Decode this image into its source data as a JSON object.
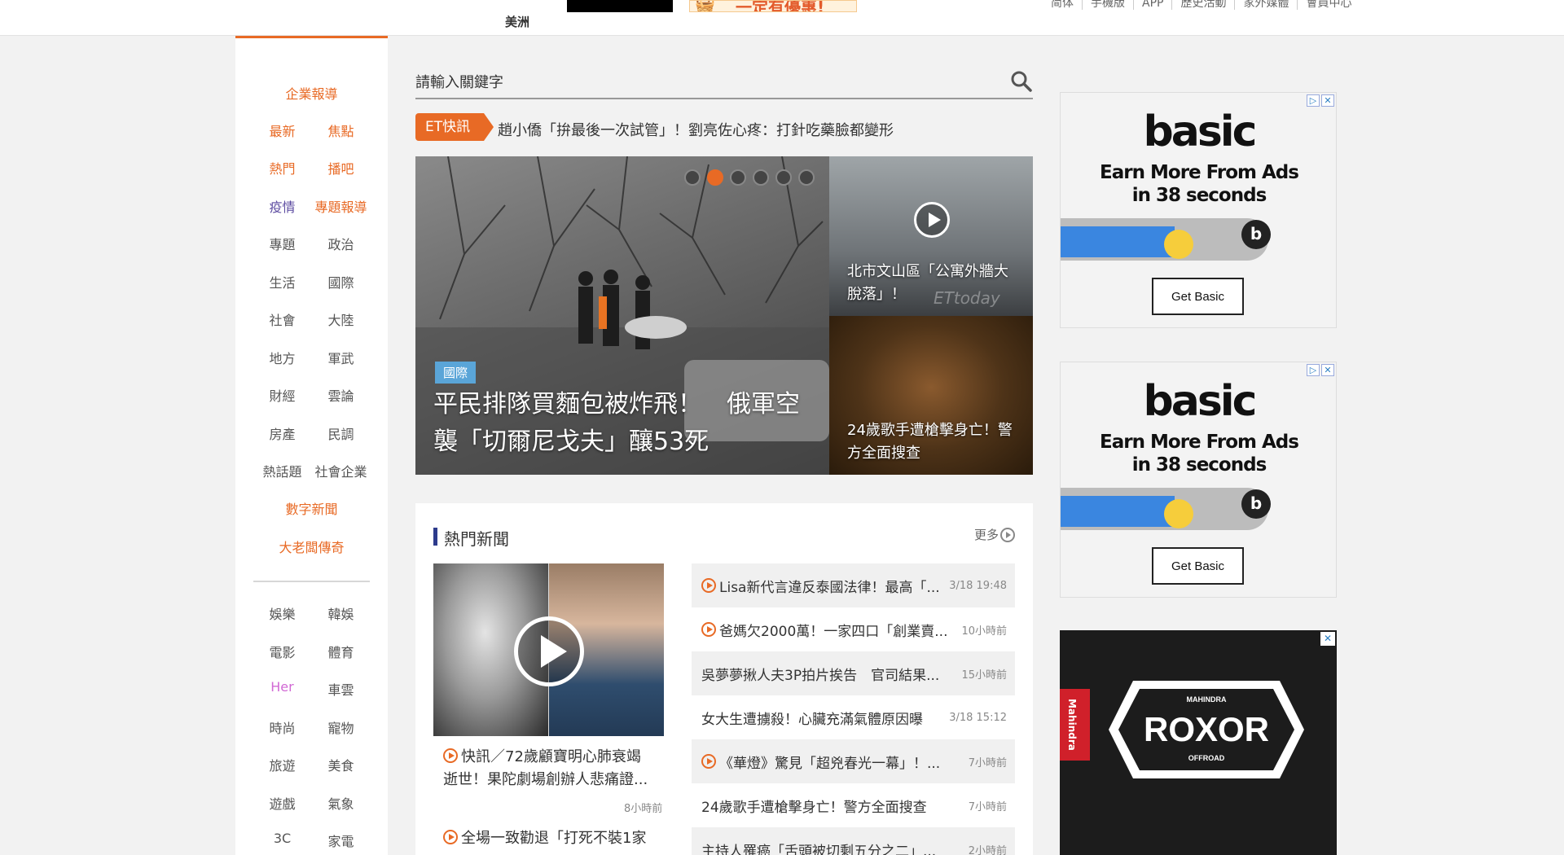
{
  "header": {
    "region": "美洲",
    "promo_text": "一定有優惠!",
    "top_links": [
      "简体",
      "手機版",
      "APP",
      "歷史活動",
      "家外媒體",
      "會員中心"
    ]
  },
  "leftnav": {
    "corporate": "企業報導",
    "group1": [
      [
        "最新",
        "焦點"
      ],
      [
        "熱門",
        "播吧"
      ],
      [
        "疫情",
        "專題報導"
      ]
    ],
    "group2": [
      [
        "專題",
        "政治"
      ],
      [
        "生活",
        "國際"
      ],
      [
        "社會",
        "大陸"
      ],
      [
        "地方",
        "軍武"
      ],
      [
        "財經",
        "雲論"
      ],
      [
        "房產",
        "民調"
      ],
      [
        "熱話題",
        "社會企業"
      ]
    ],
    "digital": "數字新聞",
    "boss": "大老闆傳奇",
    "group3": [
      [
        "娛樂",
        "韓娛"
      ],
      [
        "電影",
        "體育"
      ],
      [
        "Her",
        "車雲"
      ],
      [
        "時尚",
        "寵物"
      ],
      [
        "旅遊",
        "美食"
      ],
      [
        "遊戲",
        "氣象"
      ],
      [
        "3C",
        "家電"
      ]
    ],
    "colors": {
      "orange": "#e86a25",
      "purple": "#5b4aa0",
      "pink": "#d169d4",
      "gray": "#555555"
    }
  },
  "search": {
    "placeholder": "請輸入關鍵字",
    "icon": "search-icon"
  },
  "ticker": {
    "badge": "ET快訊",
    "text": "趙小僑「拚最後一次試管」！劉亮佐心疼：打針吃藥臉都變形"
  },
  "hero": {
    "tag": "國際",
    "title": "平民排隊買麵包被炸飛！　俄軍空襲「切爾尼戈夫」釀53死",
    "slide_count": 6,
    "active_slide": 2
  },
  "side_stories": [
    {
      "title": "北市文山區「公寓外牆大脫落」！",
      "watermark": "ETtoday"
    },
    {
      "title": "24歲歌手遭槍擊身亡！警方全面搜查"
    }
  ],
  "hot_news": {
    "title": "熱門新聞",
    "more": "更多",
    "feature": {
      "title": "快訊／72歲顧寶明心肺衰竭逝世！果陀劇場創辦人悲痛證...",
      "time": "8小時前"
    },
    "feature2_title": "全場一致勸退「打死不裝1家",
    "items": [
      {
        "video": true,
        "text": "Lisa新代言違反泰國法律！最高「...",
        "time": "3/18 19:48"
      },
      {
        "video": true,
        "text": "爸媽欠2000萬！一家四口「創業賣...",
        "time": "10小時前"
      },
      {
        "video": false,
        "text": "吳夢夢揪人夫3P拍片挨告　官司結果...",
        "time": "15小時前"
      },
      {
        "video": false,
        "text": "女大生遭擄殺！心臟充滿氣體原因曝",
        "time": "3/18 15:12"
      },
      {
        "video": true,
        "text": "《華燈》驚見「超兇春光一幕」！...",
        "time": "7小時前"
      },
      {
        "video": false,
        "text": "24歲歌手遭槍擊身亡！警方全面搜查",
        "time": "7小時前"
      },
      {
        "video": false,
        "text": "主持人罹癌「舌頭被切剩五分之二」...",
        "time": "2小時前"
      }
    ]
  },
  "ads": {
    "basic": {
      "logo": "basic",
      "headline": "Earn More From Ads in 38 seconds",
      "button": "Get Basic",
      "b_icon": "b",
      "progress": 0.5
    },
    "mahindra": {
      "side_tab": "Mahindra",
      "top_text": "MAHINDRA",
      "brand": "ROXOR",
      "bottom_text": "OFFROAD"
    }
  }
}
